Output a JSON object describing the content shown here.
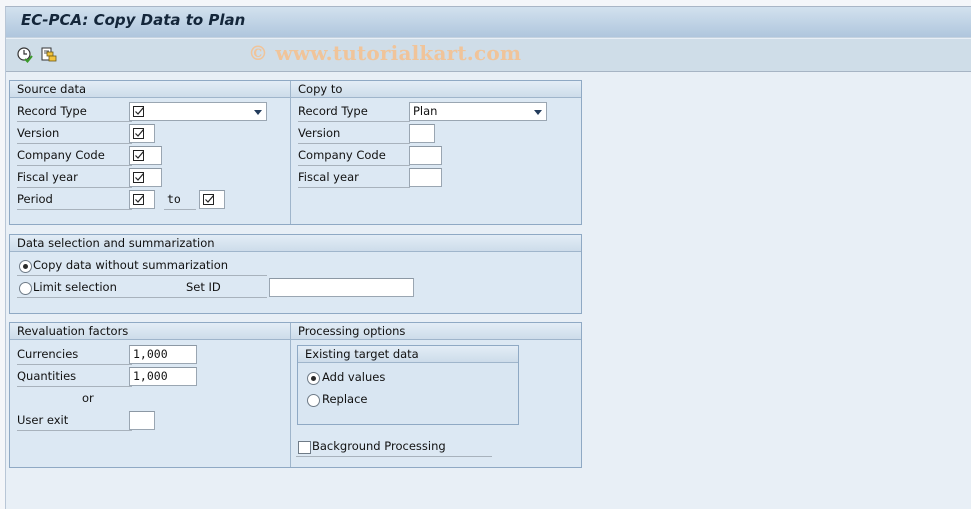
{
  "window": {
    "title": "EC-PCA: Copy Data to Plan",
    "watermark": "© www.tutorialkart.com"
  },
  "toolbar": {
    "buttons": [
      {
        "icon": "execute-in-background-icon",
        "tooltip": ""
      },
      {
        "icon": "copy-objects-icon",
        "tooltip": ""
      }
    ]
  },
  "source_data": {
    "header": "Source data",
    "record_type": {
      "label": "Record Type",
      "value": "",
      "required": true
    },
    "version": {
      "label": "Version",
      "value": "",
      "required": true
    },
    "company_code": {
      "label": "Company Code",
      "value": "",
      "required": true
    },
    "fiscal_year": {
      "label": "Fiscal year",
      "value": "",
      "required": true
    },
    "period": {
      "label": "Period",
      "from_value": "",
      "to_label": "to",
      "to_value": "",
      "required": true
    }
  },
  "copy_to": {
    "header": "Copy to",
    "record_type": {
      "label": "Record Type",
      "value": "Plan"
    },
    "version": {
      "label": "Version",
      "value": ""
    },
    "company_code": {
      "label": "Company Code",
      "value": ""
    },
    "fiscal_year": {
      "label": "Fiscal year",
      "value": ""
    }
  },
  "data_selection": {
    "header": "Data selection and summarization",
    "options": [
      {
        "label": "Copy data without summarization",
        "selected": true
      },
      {
        "label": "Limit selection",
        "selected": false
      }
    ],
    "set_id": {
      "label": "Set ID",
      "value": ""
    }
  },
  "revaluation": {
    "header": "Revaluation factors",
    "currencies": {
      "label": "Currencies",
      "value": "1,000"
    },
    "quantities": {
      "label": "Quantities",
      "value": "1,000"
    },
    "or_label": "or",
    "user_exit": {
      "label": "User exit",
      "value": ""
    }
  },
  "processing": {
    "header": "Processing options",
    "existing_target": {
      "header": "Existing target data",
      "options": [
        {
          "label": "Add values",
          "selected": true
        },
        {
          "label": "Replace",
          "selected": false
        }
      ]
    },
    "background": {
      "label": "Background Processing",
      "checked": false
    }
  }
}
